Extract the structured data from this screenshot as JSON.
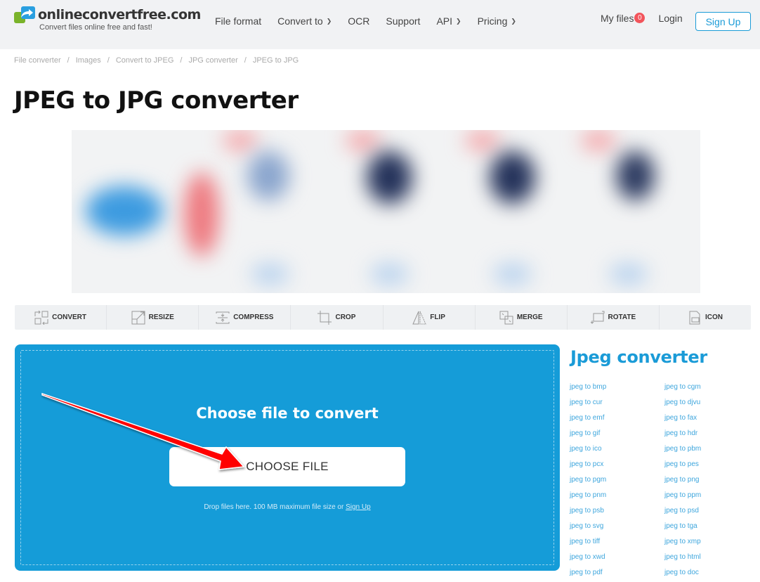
{
  "header": {
    "logo_name": "onlineconvertfree.com",
    "logo_tagline": "Convert files online free and fast!",
    "nav": [
      {
        "label": "File format",
        "dropdown": false
      },
      {
        "label": "Convert to",
        "dropdown": true
      },
      {
        "label": "OCR",
        "dropdown": false
      },
      {
        "label": "Support",
        "dropdown": false
      },
      {
        "label": "API",
        "dropdown": true
      },
      {
        "label": "Pricing",
        "dropdown": true
      }
    ],
    "my_files_label": "My files",
    "my_files_count": "0",
    "login_label": "Login",
    "signup_label": "Sign Up"
  },
  "breadcrumb": [
    "File converter",
    "Images",
    "Convert to JPEG",
    "JPG converter",
    "JPEG to JPG"
  ],
  "page_title": "JPEG to JPG converter",
  "tools": [
    {
      "label": "CONVERT",
      "icon": "convert-icon"
    },
    {
      "label": "RESIZE",
      "icon": "resize-icon"
    },
    {
      "label": "COMPRESS",
      "icon": "compress-icon"
    },
    {
      "label": "CROP",
      "icon": "crop-icon"
    },
    {
      "label": "FLIP",
      "icon": "flip-icon"
    },
    {
      "label": "MERGE",
      "icon": "merge-icon"
    },
    {
      "label": "ROTATE",
      "icon": "rotate-icon"
    },
    {
      "label": "ICON",
      "icon": "ico-file-icon"
    }
  ],
  "upload": {
    "title": "Choose file to convert",
    "button_label": "CHOOSE FILE",
    "drop_note": "Drop files here. 100 MB maximum file size or ",
    "drop_note_link": "Sign Up"
  },
  "sidebar": {
    "title": "Jpeg converter",
    "links": [
      "jpeg to bmp",
      "jpeg to cgm",
      "jpeg to cur",
      "jpeg to djvu",
      "jpeg to emf",
      "jpeg to fax",
      "jpeg to gif",
      "jpeg to hdr",
      "jpeg to ico",
      "jpeg to pbm",
      "jpeg to pcx",
      "jpeg to pes",
      "jpeg to pgm",
      "jpeg to png",
      "jpeg to pnm",
      "jpeg to ppm",
      "jpeg to psb",
      "jpeg to psd",
      "jpeg to svg",
      "jpeg to tga",
      "jpeg to tiff",
      "jpeg to xmp",
      "jpeg to xwd",
      "jpeg to html",
      "jpeg to pdf",
      "jpeg to doc"
    ]
  },
  "colors": {
    "brand_blue": "#159cd8",
    "link_blue": "#3ea6dd",
    "badge_red": "#f2545b",
    "annotation_arrow": "#ff0000"
  }
}
